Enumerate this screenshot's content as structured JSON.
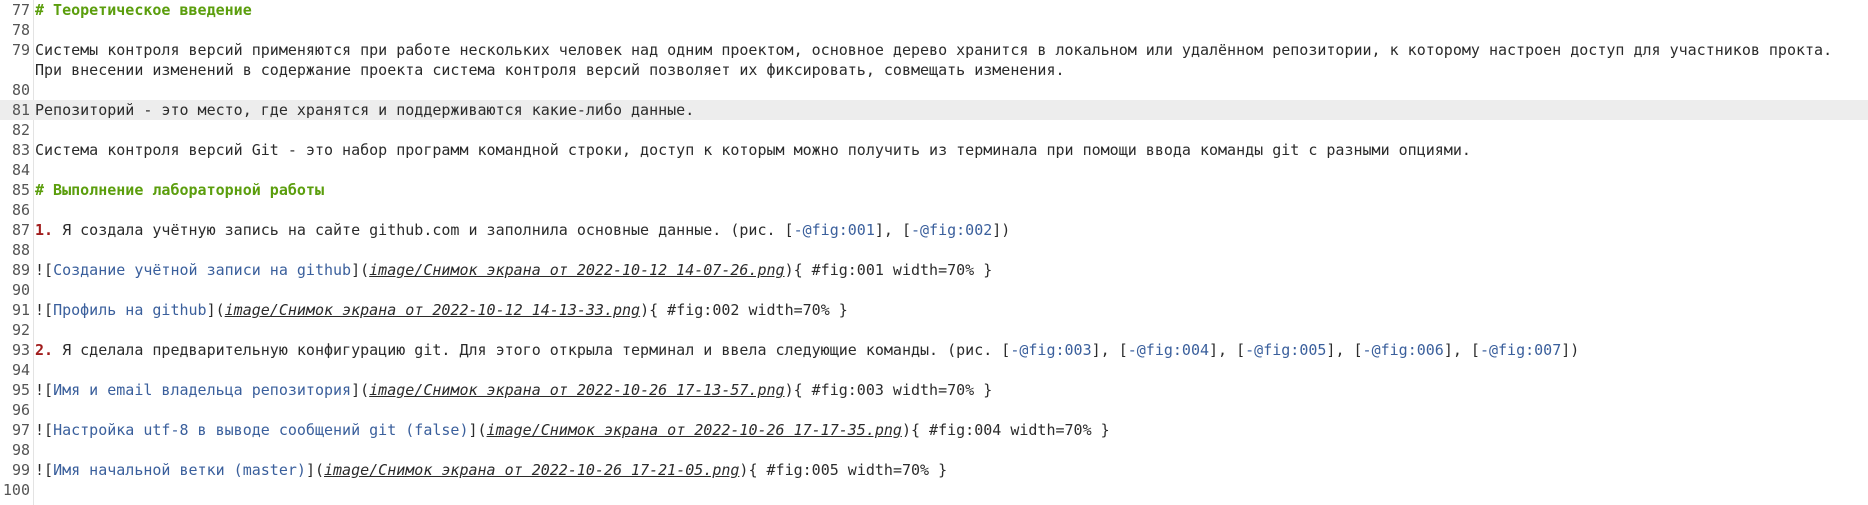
{
  "editor": {
    "lines": [
      {
        "n": "77",
        "heading": "# Теоретическое введение"
      },
      {
        "n": "78"
      },
      {
        "n": "79",
        "text": "Системы контроля версий применяются при работе нескольких человек над одним проектом, основное дерево хранится в локальном или удалённом репозитории, к которому настроен доступ для участников прокта. При внесении изменений в содержание проекта система контроля версий позволяет их фиксировать, совмещать изменения."
      },
      {
        "n": "80"
      },
      {
        "n": "81",
        "text": "Репозиторий - это место, где хранятся и поддерживаются какие-либо данные."
      },
      {
        "n": "82"
      },
      {
        "n": "83",
        "text": "Система контроля версий Git - это набор программ командной строки, доступ к которым можно получить из терминала при помощи ввода команды git с разными опциями."
      },
      {
        "n": "84"
      },
      {
        "n": "85",
        "heading": "# Выполнение лабораторной работы"
      },
      {
        "n": "86"
      },
      {
        "n": "87",
        "num": "1.",
        "text": " Я создала учётную запись на сайте github.com и заполнила основные данные. (рис. [",
        "ref1": "-@fig:001",
        "sep1": "], [",
        "ref2": "-@fig:002",
        "end": "])"
      },
      {
        "n": "88"
      },
      {
        "n": "89",
        "bang": "![",
        "alt": "Создание учётной записи на github",
        "mid": "](",
        "path": "image/Снимок экрана от 2022-10-12 14-07-26.png",
        "attrs": "){ #fig:001 width=70% }"
      },
      {
        "n": "90"
      },
      {
        "n": "91",
        "bang": "![",
        "alt": "Профиль на github",
        "mid": "](",
        "path": "image/Снимок экрана от 2022-10-12 14-13-33.png",
        "attrs": "){ #fig:002 width=70% }"
      },
      {
        "n": "92"
      },
      {
        "n": "93",
        "num": "2.",
        "text": " Я сделала предварительную конфигурацию git. Для этого открыла терминал и ввела следующие команды. (рис. [",
        "r1": "-@fig:003",
        "r2": "-@fig:004",
        "r3": "-@fig:005",
        "r4": "-@fig:006",
        "r5": "-@fig:007",
        "sep": "], [",
        "end": "])"
      },
      {
        "n": "94"
      },
      {
        "n": "95",
        "bang": "![",
        "alt": "Имя и email владельца репозитория",
        "mid": "](",
        "path": "image/Снимок экрана от 2022-10-26 17-13-57.png",
        "attrs": "){ #fig:003 width=70% }"
      },
      {
        "n": "96"
      },
      {
        "n": "97",
        "bang": "![",
        "alt": "Настройка utf-8 в выводе сообщений git (false)",
        "mid": "](",
        "path": "image/Снимок экрана от 2022-10-26 17-17-35.png",
        "attrs": "){ #fig:004 width=70% }"
      },
      {
        "n": "98"
      },
      {
        "n": "99",
        "bang": "![",
        "alt": "Имя начальной ветки (master)",
        "mid": "](",
        "path": "image/Снимок экрана от 2022-10-26 17-21-05.png",
        "attrs": "){ #fig:005 width=70% }"
      },
      {
        "n": "100"
      }
    ]
  }
}
